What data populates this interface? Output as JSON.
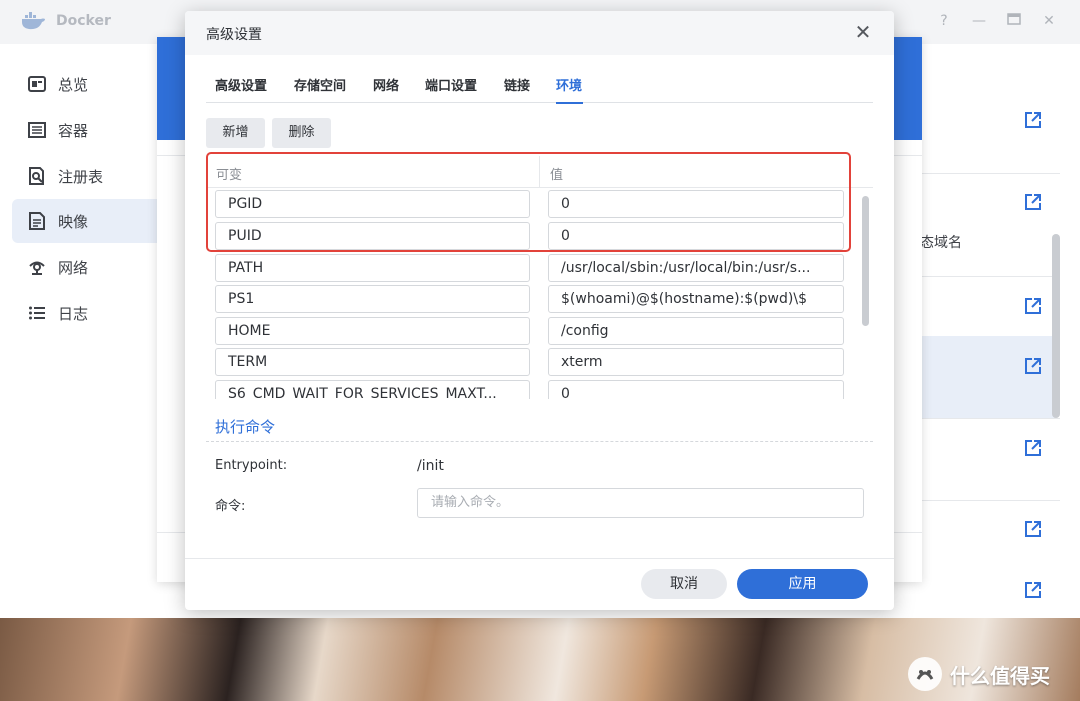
{
  "app": {
    "title": "Docker"
  },
  "sidebar": {
    "items": [
      {
        "label": "总览",
        "icon": "overview-icon",
        "active": false
      },
      {
        "label": "容器",
        "icon": "container-icon",
        "active": false
      },
      {
        "label": "注册表",
        "icon": "registry-icon",
        "active": false
      },
      {
        "label": "映像",
        "icon": "image-icon",
        "active": true
      },
      {
        "label": "网络",
        "icon": "network-icon",
        "active": false
      },
      {
        "label": "日志",
        "icon": "log-icon",
        "active": false
      }
    ]
  },
  "background": {
    "partial_text": "态域名"
  },
  "dialog": {
    "title": "高级设置",
    "tabs": [
      {
        "label": "高级设置",
        "active": false
      },
      {
        "label": "存储空间",
        "active": false
      },
      {
        "label": "网络",
        "active": false
      },
      {
        "label": "端口设置",
        "active": false
      },
      {
        "label": "链接",
        "active": false
      },
      {
        "label": "环境",
        "active": true
      }
    ],
    "add_button": "新增",
    "delete_button": "删除",
    "env_table": {
      "headers": {
        "variable": "可变",
        "value": "值"
      },
      "rows": [
        {
          "key": "PGID",
          "value": "0"
        },
        {
          "key": "PUID",
          "value": "0"
        },
        {
          "key": "PATH",
          "value": "/usr/local/sbin:/usr/local/bin:/usr/s..."
        },
        {
          "key": "PS1",
          "value": "$(whoami)@$(hostname):$(pwd)\\$"
        },
        {
          "key": "HOME",
          "value": "/config"
        },
        {
          "key": "TERM",
          "value": "xterm"
        },
        {
          "key": "S6_CMD_WAIT_FOR_SERVICES_MAXT...",
          "value": "0"
        }
      ]
    },
    "exec_section": {
      "title": "执行命令",
      "entrypoint_label": "Entrypoint:",
      "entrypoint_value": "/init",
      "command_label": "命令:",
      "command_placeholder": "请输入命令。"
    },
    "cancel_button": "取消",
    "apply_button": "应用"
  },
  "watermark": {
    "text": "什么值得买"
  },
  "colors": {
    "accent": "#2f6fd8",
    "highlight": "#e2423a"
  }
}
